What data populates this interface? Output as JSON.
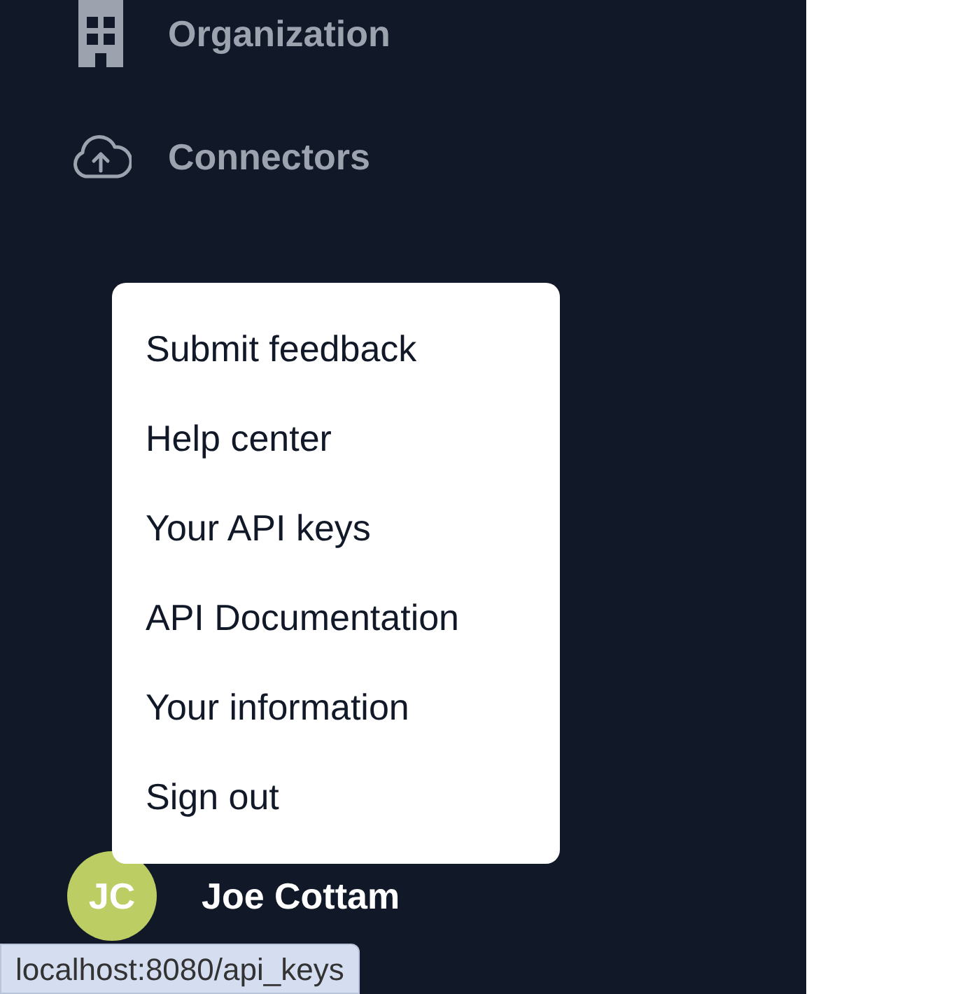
{
  "sidebar": {
    "items": [
      {
        "label": "Organization",
        "kind": "building"
      },
      {
        "label": "Connectors",
        "kind": "cloud"
      }
    ],
    "user": {
      "initials": "JC",
      "name": "Joe Cottam"
    }
  },
  "menu": {
    "items": [
      "Submit feedback",
      "Help center",
      "Your API keys",
      "API Documentation",
      "Your information",
      "Sign out"
    ]
  },
  "status_bar": {
    "url": "localhost:8080/api_keys"
  }
}
